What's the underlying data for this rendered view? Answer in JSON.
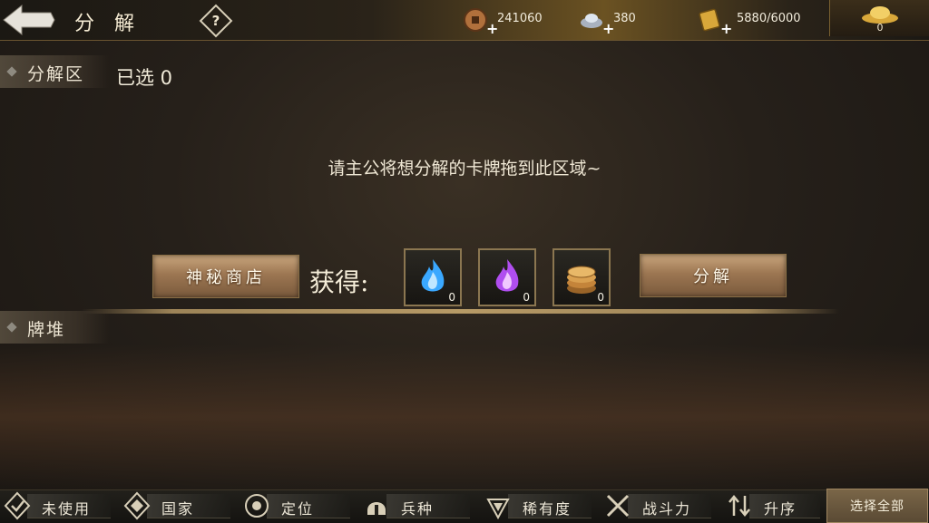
{
  "header": {
    "title": "分解",
    "help_label": "?"
  },
  "resources": {
    "copper": "241060",
    "silver": "380",
    "stamina": "5880/6000",
    "gold_ingot": "0"
  },
  "decompose_area": {
    "label": "分解区",
    "selected_text": "已选 0",
    "hint": "请主公将想分解的卡牌拖到此区域~"
  },
  "actions": {
    "shop_label": "神秘商店",
    "gain_label": "获得:",
    "decompose_label": "分解",
    "rewards": [
      {
        "icon": "blue-flame-icon",
        "count": "0"
      },
      {
        "icon": "purple-flame-icon",
        "count": "0"
      },
      {
        "icon": "coin-stack-icon",
        "count": "0"
      }
    ]
  },
  "deck": {
    "label": "牌堆"
  },
  "filters": [
    {
      "label": "未使用",
      "icon": "unused-icon"
    },
    {
      "label": "国家",
      "icon": "nation-icon"
    },
    {
      "label": "定位",
      "icon": "position-icon"
    },
    {
      "label": "兵种",
      "icon": "helmet-icon"
    },
    {
      "label": "稀有度",
      "icon": "rarity-icon"
    },
    {
      "label": "战斗力",
      "icon": "crossed-swords-icon"
    },
    {
      "label": "升序",
      "icon": "sort-icon"
    }
  ],
  "select_all_label": "选择全部",
  "colors": {
    "accent_gold": "#b79a66",
    "button_gold": "#9c7652"
  }
}
